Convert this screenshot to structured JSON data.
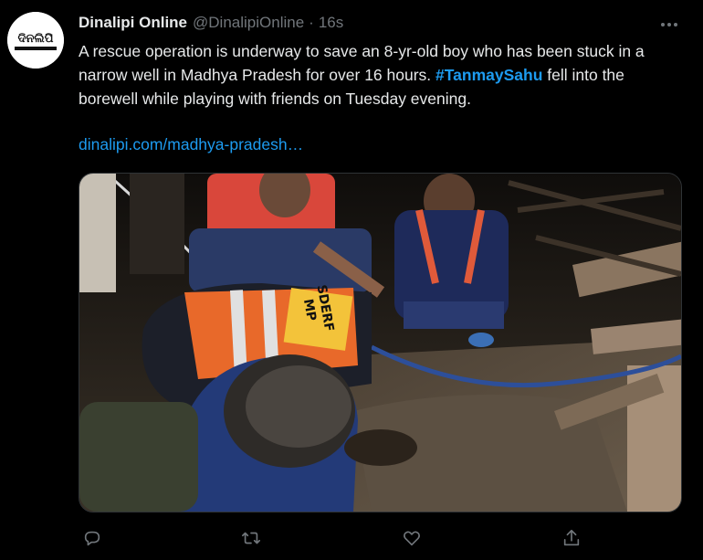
{
  "tweet": {
    "author_name": "Dinalipi Online",
    "author_handle": "@DinalipiOnline",
    "separator": "·",
    "timestamp": "16s",
    "avatar_text": "ଦିନଲିପି",
    "text_before_hashtag": "A rescue operation is underway to save an 8-yr-old boy who has been stuck in a narrow well in Madhya Pradesh for over 16 hours. ",
    "hashtag": "#TanmaySahu",
    "text_after_hashtag": " fell into the borewell while playing with friends on Tuesday evening.",
    "link_text": "dinalipi.com/madhya-pradesh…",
    "vest_text_line1": "SDERF",
    "vest_text_line2": "MP"
  },
  "actions": {
    "reply_icon": "reply-icon",
    "retweet_icon": "retweet-icon",
    "like_icon": "heart-icon",
    "share_icon": "share-icon"
  },
  "colors": {
    "background": "#000000",
    "text": "#e7e9ea",
    "muted": "#71767b",
    "accent": "#1d9bf0",
    "vest_orange": "#e8692a"
  }
}
